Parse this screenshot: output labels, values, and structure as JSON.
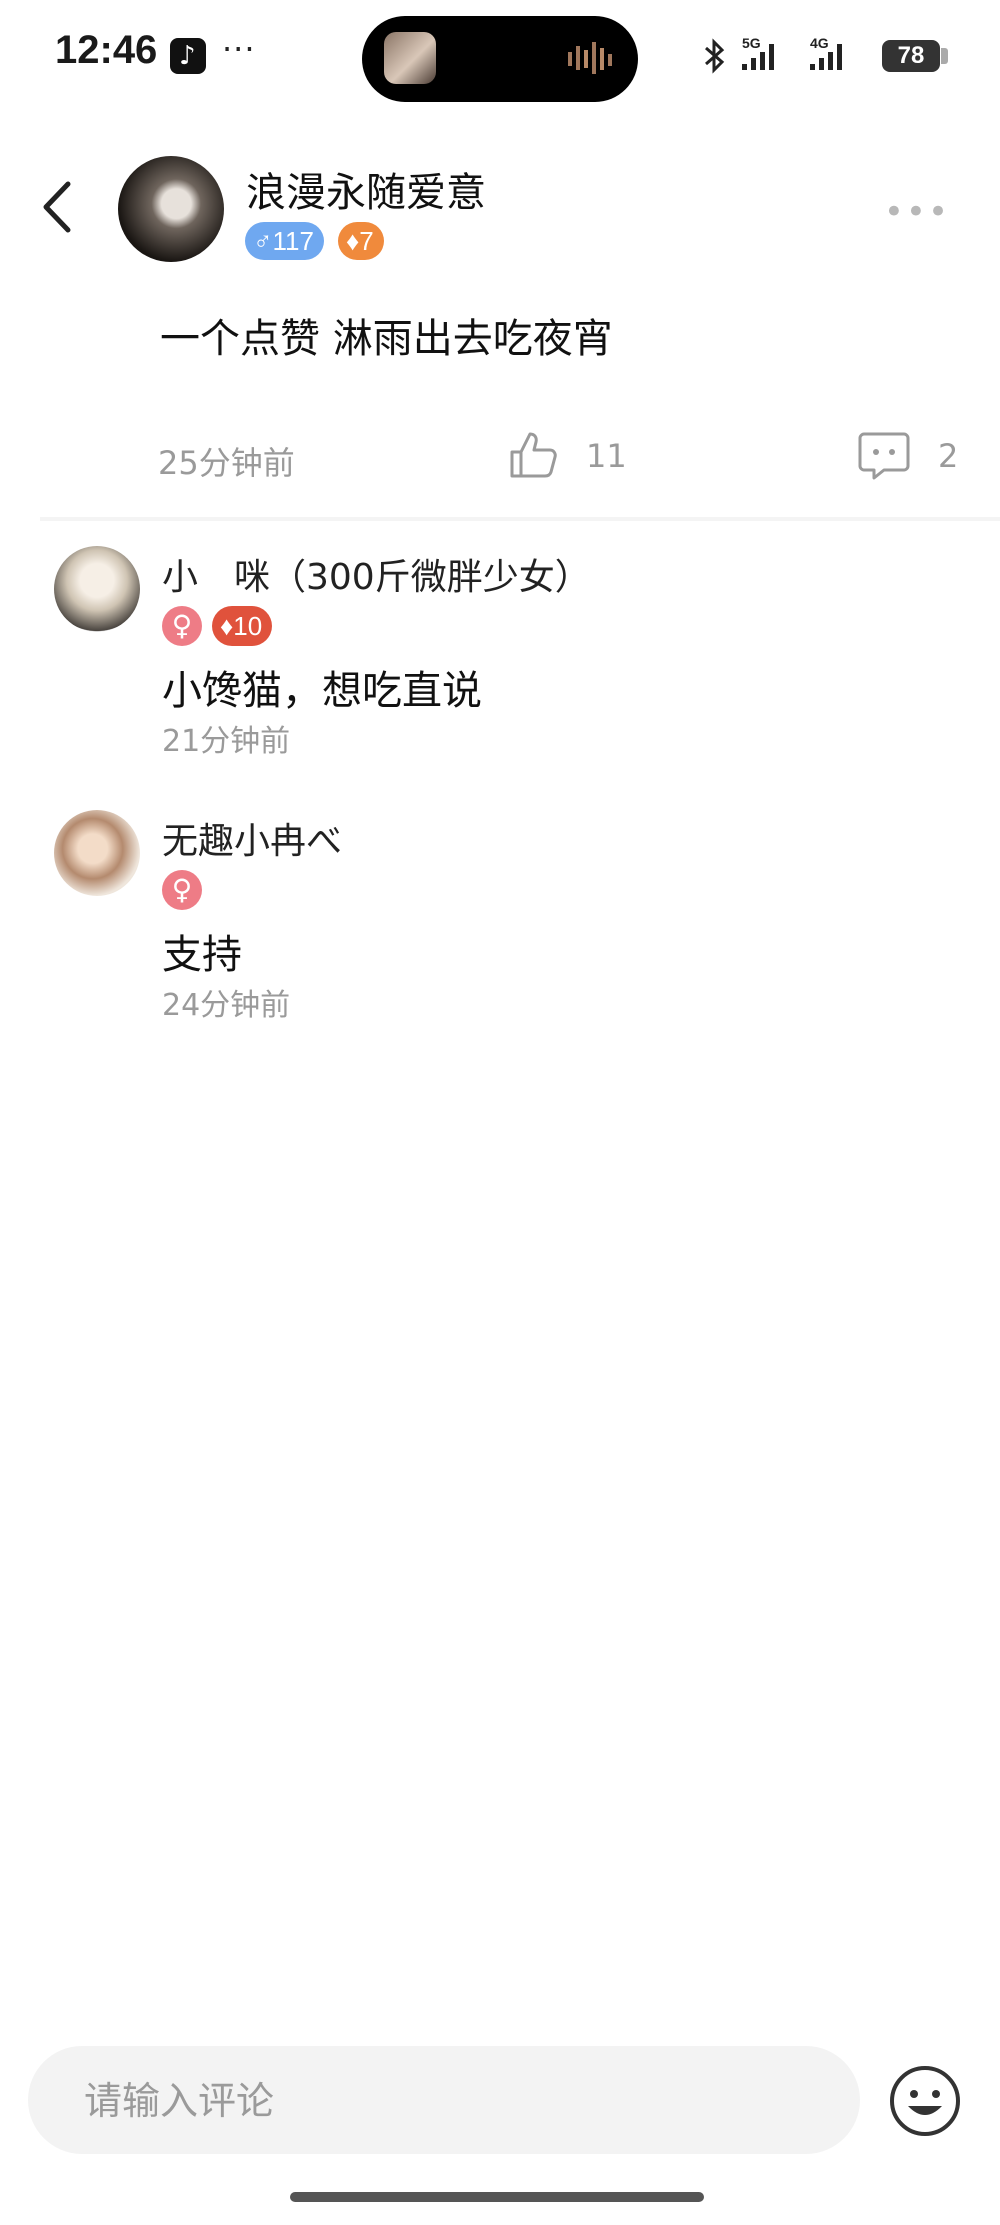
{
  "status_bar": {
    "time": "12:46",
    "tiktok_glyph": "♪",
    "more_dots": "···",
    "network_5g": "5G",
    "network_4g": "4G",
    "battery": "78",
    "icons": [
      "tiktok-icon",
      "bluetooth-icon",
      "signal-icon",
      "battery-icon"
    ]
  },
  "post": {
    "author": "浪漫永随爱意",
    "badges": {
      "male_level": "♂117",
      "fire_level": "♦7"
    },
    "text": "一个点赞 淋雨出去吃夜宵",
    "time": "25分钟前",
    "likes": "11",
    "comments": "2"
  },
  "comments": [
    {
      "name": "小　咪（300斤微胖少女）",
      "gender": "♀",
      "level": "♦10",
      "text": "小馋猫，想吃直说",
      "time": "21分钟前"
    },
    {
      "name": "无趣小冉べ",
      "gender": "♀",
      "text": "支持",
      "time": "24分钟前"
    }
  ],
  "input": {
    "placeholder": "请输入评论"
  },
  "colors": {
    "badge_blue": "#6fa8f0",
    "badge_orange": "#f08a3c",
    "badge_red": "#e0523c",
    "female_pink": "#ee7c86"
  }
}
